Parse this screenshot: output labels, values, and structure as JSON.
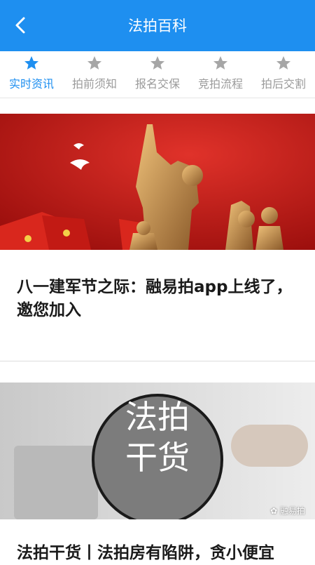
{
  "header": {
    "title": "法拍百科",
    "back_icon": "chevron-left-icon"
  },
  "tabs": [
    {
      "label": "实时资讯",
      "active": true
    },
    {
      "label": "拍前须知",
      "active": false
    },
    {
      "label": "报名交保",
      "active": false
    },
    {
      "label": "竞拍流程",
      "active": false
    },
    {
      "label": "拍后交割",
      "active": false
    }
  ],
  "colors": {
    "accent": "#1e8ff0",
    "inactive": "#9b9b9b"
  },
  "articles": [
    {
      "title": "八一建军节之际：融易拍app上线了，邀您加入"
    },
    {
      "title": "法拍干货丨法拍房有陷阱，贪小便宜",
      "badge_line1": "法拍",
      "badge_line2": "干货",
      "watermark": "融易拍"
    }
  ]
}
